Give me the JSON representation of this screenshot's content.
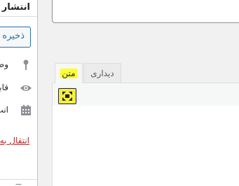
{
  "sidebar": {
    "title": "انتشار",
    "save_label": "ذخیره",
    "rows": [
      {
        "label": "وضع",
        "icon": "pin-icon"
      },
      {
        "label": "قابل",
        "icon": "eye-icon"
      },
      {
        "label": "انت",
        "icon": "calendar-icon"
      }
    ],
    "trash_link": "انتقال به",
    "next_box_fragment": "—"
  },
  "editor": {
    "tabs": [
      {
        "label": "متن",
        "active": true
      },
      {
        "label": "دیداری",
        "active": false
      }
    ],
    "toolbar": {
      "fullscreen_icon": "fullscreen-icon"
    }
  },
  "colors": {
    "accent": "#2271b1",
    "trash_link": "#b32d2e",
    "highlight": "#fdff31"
  }
}
